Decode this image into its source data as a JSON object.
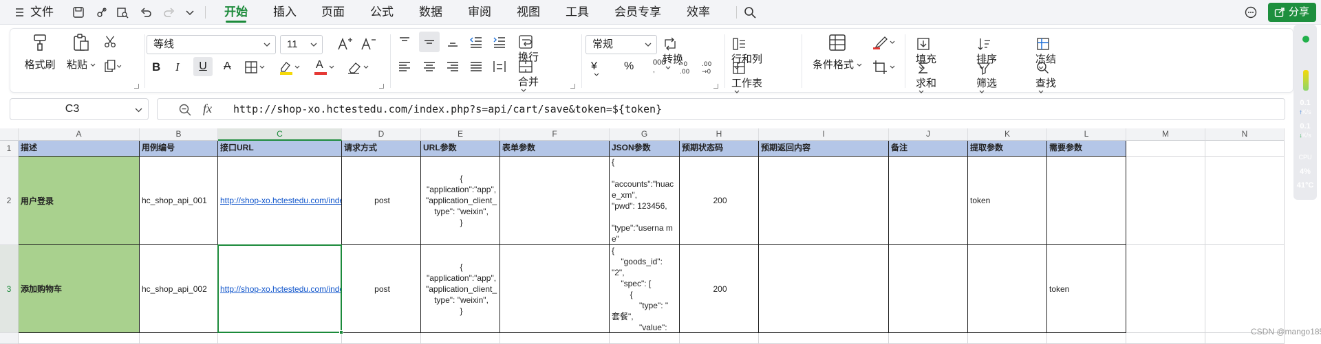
{
  "menu": {
    "file_label": "文件",
    "tabs": [
      "开始",
      "插入",
      "页面",
      "公式",
      "数据",
      "审阅",
      "视图",
      "工具",
      "会员专享",
      "效率"
    ],
    "active_tab": "开始",
    "share_label": "分享"
  },
  "ribbon": {
    "format_painter": "格式刷",
    "paste": "粘贴",
    "font_name": "等线",
    "font_size": "11",
    "wrap": "换行",
    "merge": "合并",
    "number_format": "常规",
    "convert": "转换",
    "row_col": "行和列",
    "worksheet": "工作表",
    "cond_format": "条件格式",
    "fill": "填充",
    "sort": "排序",
    "freeze": "冻结",
    "sum": "求和",
    "filter": "筛选",
    "find": "查找",
    "bold": "B",
    "italic": "I",
    "underline": "U",
    "strike": "A",
    "font_color_letter": "A",
    "percent": "%",
    "thousands": "000",
    "yen": "¥",
    "font_color": "#e53935",
    "highlight_color": "#f5d90a"
  },
  "monitor": {
    "up_speed": "0.1",
    "up_unit": "K/s",
    "down_speed": "0.1",
    "down_unit": "K/s",
    "cpu_label": "CPU",
    "cpu_value": "4%",
    "temp": "41°C"
  },
  "formula_bar": {
    "name_box": "C3",
    "fx_label": "fx",
    "formula": "http://shop-xo.hctestedu.com/index.php?s=api/cart/save&token=${token}"
  },
  "grid": {
    "columns": [
      "A",
      "B",
      "C",
      "D",
      "E",
      "F",
      "G",
      "H",
      "I",
      "J",
      "K",
      "L",
      "M",
      "N"
    ],
    "rows": [
      "1",
      "2",
      "3"
    ],
    "headers": [
      "描述",
      "用例编号",
      "接口URL",
      "请求方式",
      "URL参数",
      "表单参数",
      "JSON参数",
      "预期状态码",
      "预期返回内容",
      "备注",
      "提取参数",
      "需要参数"
    ],
    "row2": {
      "desc": "用户登录",
      "case_id": "hc_shop_api_001",
      "url": "http://shop-xo.hctestedu.com/index.php?s=api/user/login",
      "method": "post",
      "url_params": "{\n\"application\":\"app\",\n\"application_client_\ntype\": \"weixin\",\n}",
      "json_params": "{\n\n\"accounts\":\"huac\ne_xm\",\n\"pwd\": 123456,\n\n\"type\":\"userna m\ne\"",
      "status": "200",
      "extract": "token",
      "need": ""
    },
    "row3": {
      "desc": "添加购物车",
      "case_id": "hc_shop_api_002",
      "url": "http://shop-xo.hctestedu.com/index.php?s=api/cart/save&token=${token}",
      "method": "post",
      "url_params": "{\n\"application\":\"app\",\n\"application_client_\ntype\": \"weixin\",\n}",
      "json_params": "{\n    \"goods_id\":\n\"2\",\n    \"spec\": [\n        {\n            \"type\": \"\n套餐\",\n            \"value\":",
      "status": "200",
      "extract": "",
      "need": "token"
    }
  },
  "watermark": "CSDN @mango185"
}
